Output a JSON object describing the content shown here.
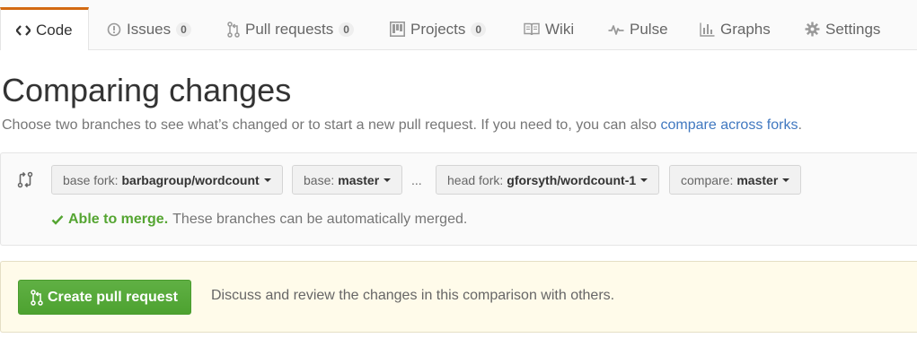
{
  "tabs": {
    "code": {
      "label": "Code",
      "icon": "code-icon"
    },
    "issues": {
      "label": "Issues",
      "count": "0",
      "icon": "issue-opened-icon"
    },
    "pull_requests": {
      "label": "Pull requests",
      "count": "0",
      "icon": "git-pull-request-icon"
    },
    "projects": {
      "label": "Projects",
      "count": "0",
      "icon": "project-icon"
    },
    "wiki": {
      "label": "Wiki",
      "icon": "book-icon"
    },
    "pulse": {
      "label": "Pulse",
      "icon": "pulse-icon"
    },
    "graphs": {
      "label": "Graphs",
      "icon": "graph-icon"
    },
    "settings": {
      "label": "Settings",
      "icon": "gear-icon"
    }
  },
  "header": {
    "title": "Comparing changes",
    "subtitle_text": "Choose two branches to see what’s changed or to start a new pull request. If you need to, you can also",
    "subtitle_link": "compare across forks",
    "subtitle_end": "."
  },
  "range": {
    "base_fork": {
      "label": "base fork:",
      "value": "barbagroup/wordcount"
    },
    "base": {
      "label": "base:",
      "value": "master"
    },
    "ellipsis": "...",
    "head_fork": {
      "label": "head fork:",
      "value": "gforsyth/wordcount-1"
    },
    "compare": {
      "label": "compare:",
      "value": "master"
    },
    "merge_status": {
      "headline": "Able to merge.",
      "detail": "These branches can be automatically merged."
    }
  },
  "banner": {
    "button_label": "Create pull request",
    "description": "Discuss and review the changes in this comparison with others."
  },
  "colors": {
    "tab_accent": "#d26911",
    "link": "#4078c0",
    "success": "#55a532",
    "button_green": "#55a532",
    "banner_bg": "#fffbea"
  }
}
